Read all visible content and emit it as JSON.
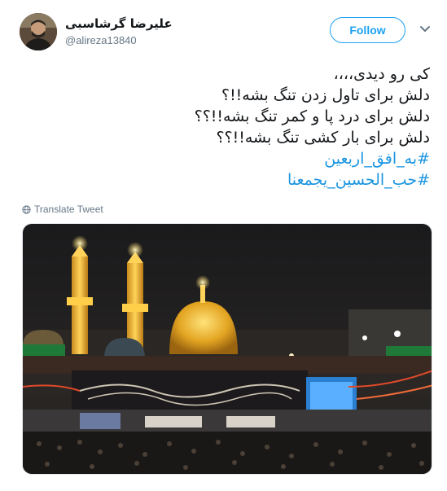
{
  "user": {
    "display_name": "علیرضا گرشاسبی",
    "handle": "@alireza13840",
    "avatar_icon": "user-avatar-photo"
  },
  "follow_button": {
    "label": "Follow"
  },
  "menu": {
    "icon": "chevron-down-icon"
  },
  "tweet": {
    "lines": [
      "کی رو دیدی،،،،",
      "دلش برای تاول زدن تنگ بشه!!؟",
      "دلش برای درد پا و کمر تنگ بشه!!؟؟",
      "دلش برای بار کشی تنگ بشه!!؟؟"
    ],
    "hashtags": [
      "#به_افق_اربعین",
      "#حب_الحسین_یجمعنا"
    ]
  },
  "translate": {
    "label": "Translate Tweet",
    "icon": "globe-icon"
  },
  "media": {
    "alt_icon": "shrine-photo"
  },
  "colors": {
    "accent": "#1da1f2",
    "hashtag": "#1b95e0",
    "text": "#14171a",
    "secondary": "#657786"
  }
}
